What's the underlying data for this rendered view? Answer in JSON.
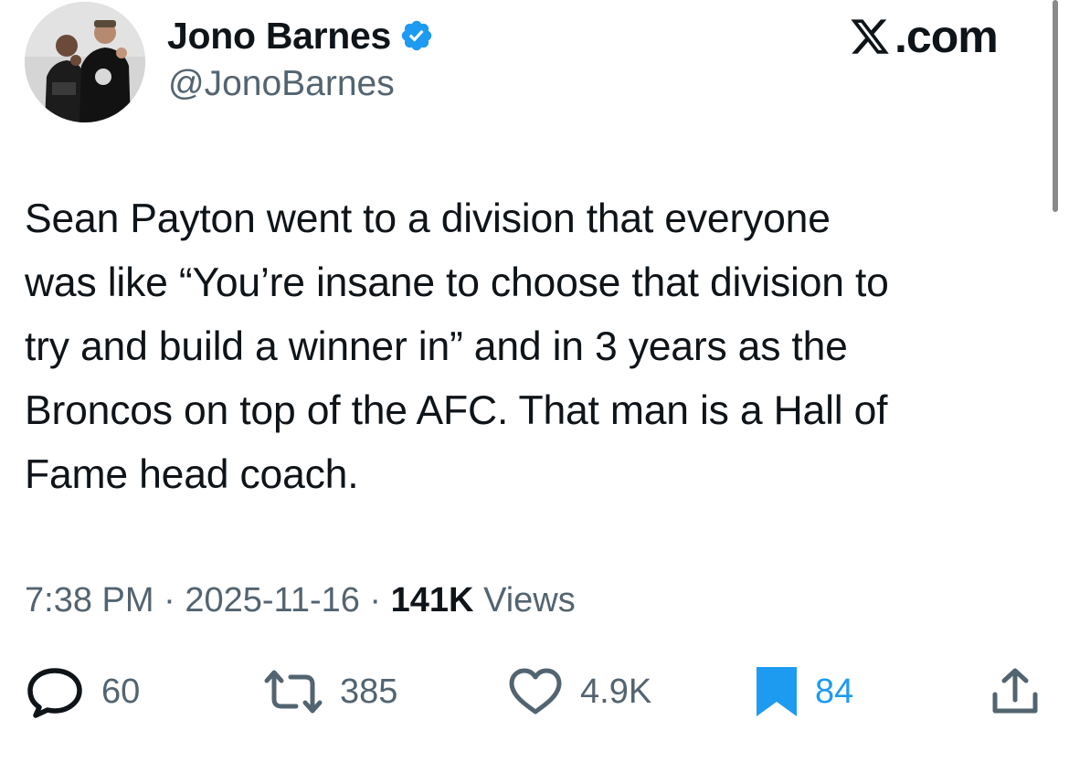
{
  "author": {
    "display_name": "Jono Barnes",
    "handle": "@JonoBarnes",
    "verified": true,
    "avatar_icon": "profile-photo"
  },
  "brand": {
    "icon": "x-logo-icon",
    "text": ".com"
  },
  "tweet": {
    "text": "Sean Payton went to a division that everyone\nwas like “You’re insane to choose that division to\ntry and build a winner in” and in 3 years as the\nBroncos on top of the AFC. That man is a Hall of\nFame head coach."
  },
  "meta": {
    "time": "7:38 PM",
    "separator": " · ",
    "date": "2025-11-16",
    "views_count": "141K",
    "views_label": "Views"
  },
  "actions": {
    "replies": {
      "icon": "reply-icon",
      "count": "60"
    },
    "reposts": {
      "icon": "repost-icon",
      "count": "385"
    },
    "likes": {
      "icon": "heart-icon",
      "count": "4.9K"
    },
    "bookmarks": {
      "icon": "bookmark-icon",
      "count": "84",
      "active": true
    },
    "share": {
      "icon": "share-icon"
    }
  },
  "colors": {
    "text": "#0f1419",
    "secondary_text": "#536471",
    "accent": "#1d9bf0",
    "background": "#ffffff"
  }
}
